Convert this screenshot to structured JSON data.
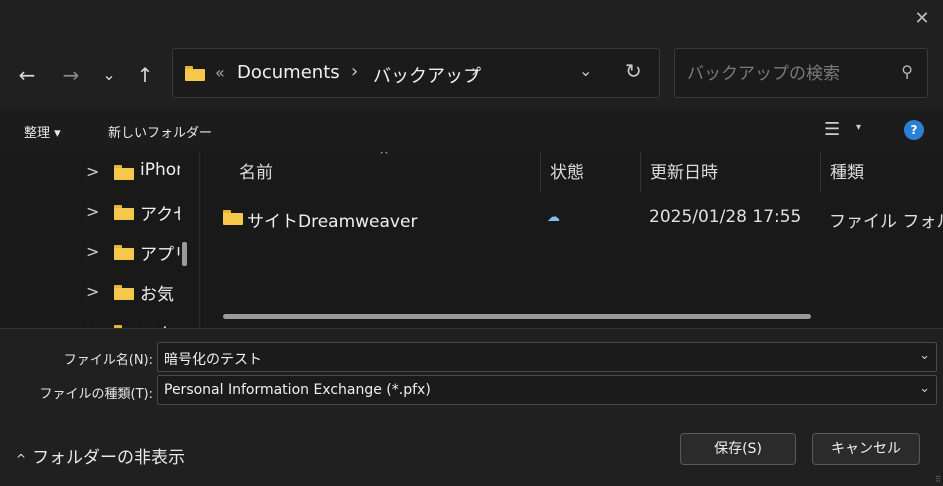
{
  "dialog": {
    "close_glyph": "✕"
  },
  "nav": {
    "back": "←",
    "forward": "→",
    "recent": "⌄",
    "up": "↑"
  },
  "address": {
    "overflow": "«",
    "crumbs": [
      "Documents",
      "バックアップ"
    ],
    "separator": "›",
    "dropdown": "⌄",
    "refresh": "↻"
  },
  "search": {
    "placeholder": "バックアップの検索",
    "icon": "⚲"
  },
  "toolbar": {
    "organize_label": "整理 ▾",
    "new_folder_label": "新しいフォルダー",
    "view_icon": "☰",
    "view_dropdown": "▾",
    "help_label": "?"
  },
  "tree": {
    "arrow": ">",
    "items": [
      {
        "label": "iPhone"
      },
      {
        "label": "アクセ"
      },
      {
        "label": "アプリ"
      },
      {
        "label": "お気"
      },
      {
        "label": "スク"
      }
    ]
  },
  "filelist": {
    "sort_indicator": "^",
    "columns": [
      {
        "label": "名前"
      },
      {
        "label": "状態"
      },
      {
        "label": "更新日時"
      },
      {
        "label": "種類"
      }
    ],
    "rows": [
      {
        "name": "サイトDreamweaver",
        "status_icon": "☁",
        "date": "2025/01/28 17:55",
        "type": "ファイル フォルダー"
      }
    ]
  },
  "form": {
    "filename_label": "ファイル名(N):",
    "filename_value": "暗号化のテスト",
    "filetype_label": "ファイルの種類(T):",
    "filetype_value": "Personal Information Exchange (*.pfx)",
    "dropdown_glyph": "⌄"
  },
  "footer": {
    "hide_folders_caret": "^",
    "hide_folders_label": "フォルダーの非表示",
    "save_label": "保存(S)",
    "cancel_label": "キャンセル",
    "grip": "⠿"
  },
  "colors": {
    "folder": "#f5c84c",
    "accent_help": "#2a7fd6",
    "cloud": "#7ec3f0"
  }
}
